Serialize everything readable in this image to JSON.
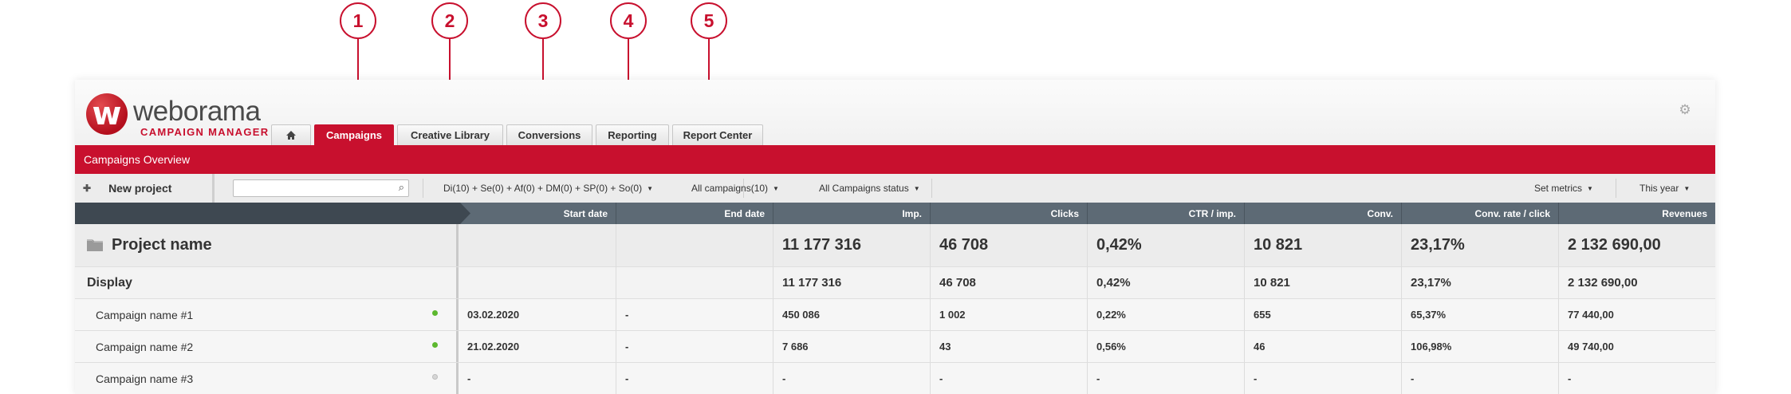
{
  "callouts": [
    "1",
    "2",
    "3",
    "4",
    "5"
  ],
  "brand": {
    "name": "weborama",
    "subtitle": "CAMPAIGN MANAGER",
    "mark": "w",
    "color": "#c8102e"
  },
  "tabs": [
    {
      "label": "",
      "icon": "home-icon"
    },
    {
      "label": "Campaigns",
      "active": true
    },
    {
      "label": "Creative Library"
    },
    {
      "label": "Conversions"
    },
    {
      "label": "Reporting"
    },
    {
      "label": "Report Center"
    }
  ],
  "settings_icon": "gear-icon",
  "page_title": "Campaigns Overview",
  "toolbar": {
    "new_project_label": "New project",
    "search_value": "",
    "filter_formats": "Di(10) + Se(0) + Af(0) + DM(0) + SP(0) + So(0)",
    "filter_campaigns": "All campaigns(10)",
    "filter_status": "All Campaigns status",
    "set_metrics": "Set metrics",
    "period": "This year"
  },
  "table": {
    "columns": [
      "Start date",
      "End date",
      "Imp.",
      "Clicks",
      "CTR / imp.",
      "Conv.",
      "Conv. rate / click",
      "Revenues"
    ],
    "project": {
      "name": "Project name",
      "values": [
        "",
        "",
        "11 177 316",
        "46 708",
        "0,42%",
        "10 821",
        "23,17%",
        "2 132 690,00"
      ]
    },
    "group": {
      "name": "Display",
      "values": [
        "",
        "",
        "11 177 316",
        "46 708",
        "0,42%",
        "10 821",
        "23,17%",
        "2 132 690,00"
      ]
    },
    "campaigns": [
      {
        "name": "Campaign name #1",
        "status": "active",
        "values": [
          "03.02.2020",
          "-",
          "450 086",
          "1 002",
          "0,22%",
          "655",
          "65,37%",
          "77 440,00"
        ]
      },
      {
        "name": "Campaign name #2",
        "status": "active",
        "values": [
          "21.02.2020",
          "-",
          "7 686",
          "43",
          "0,56%",
          "46",
          "106,98%",
          "49 740,00"
        ]
      },
      {
        "name": "Campaign name #3",
        "status": "inactive",
        "values": [
          "-",
          "-",
          "-",
          "-",
          "-",
          "-",
          "-",
          "-"
        ]
      }
    ]
  },
  "colors": {
    "accent": "#c8102e",
    "header_bar": "#5d6a75",
    "status_active": "#5cb82e",
    "status_inactive": "#cfcfcf"
  }
}
